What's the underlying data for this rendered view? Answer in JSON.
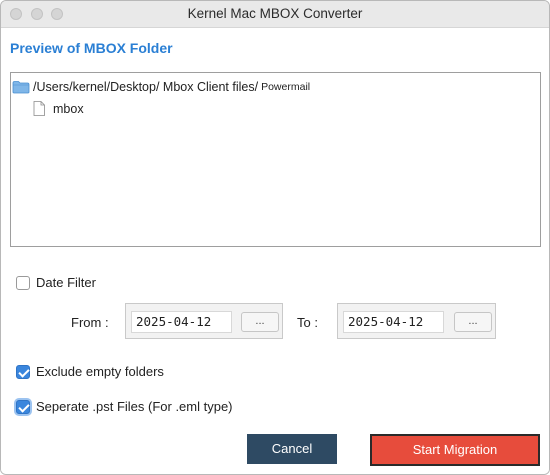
{
  "window": {
    "title": "Kernel Mac MBOX Converter"
  },
  "preview": {
    "heading": "Preview of MBOX Folder",
    "root_path": "/Users/kernel/Desktop/ Mbox Client files/",
    "root_path_tail": "Powermail",
    "child_name": "mbox"
  },
  "date_filter": {
    "label": "Date Filter",
    "checked": false,
    "from_label": "From :",
    "from_value": "2025-04-12",
    "from_button": "...",
    "to_label": "To :",
    "to_value": "2025-04-12",
    "to_button": "..."
  },
  "options": {
    "exclude_empty": {
      "label": "Exclude empty folders",
      "checked": true
    },
    "separate_pst": {
      "label": "Seperate .pst Files (For .eml type)",
      "checked": true
    }
  },
  "buttons": {
    "cancel": "Cancel",
    "start": "Start Migration"
  },
  "colors": {
    "accent": "#2a7fd4",
    "checkbox": "#3a86dd",
    "cancel_bg": "#2e4a63",
    "start_bg": "#e74c3c"
  },
  "icons": {
    "root": "folder-icon",
    "child": "file-icon",
    "checked": "checkmark-icon"
  }
}
